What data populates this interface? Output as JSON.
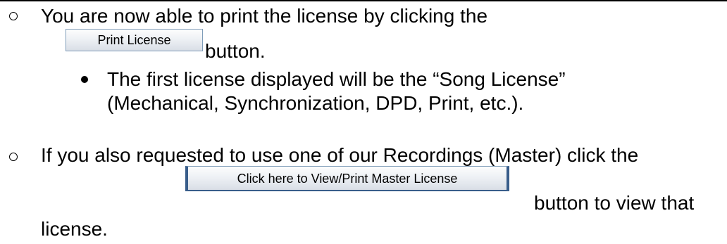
{
  "items": [
    {
      "text_before": "You are now able to print the license by clicking the",
      "button_label": "Print License",
      "text_after": "button.",
      "sub_bullet": {
        "line1": "The first license displayed will be the “Song License”",
        "line2": "(Mechanical, Synchronization, DPD, Print, etc.)."
      }
    },
    {
      "text_before": "If you also requested to use one of our Recordings (Master) click the",
      "button_label": "Click here to View/Print Master License",
      "text_after": "button to view that",
      "text_continued": "license."
    }
  ],
  "icons": {
    "level1": "hollow-circle-bullet",
    "level2": "filled-dot-bullet"
  },
  "colors": {
    "button_border": "#7f9db9",
    "button_accent": "#385d8a"
  }
}
